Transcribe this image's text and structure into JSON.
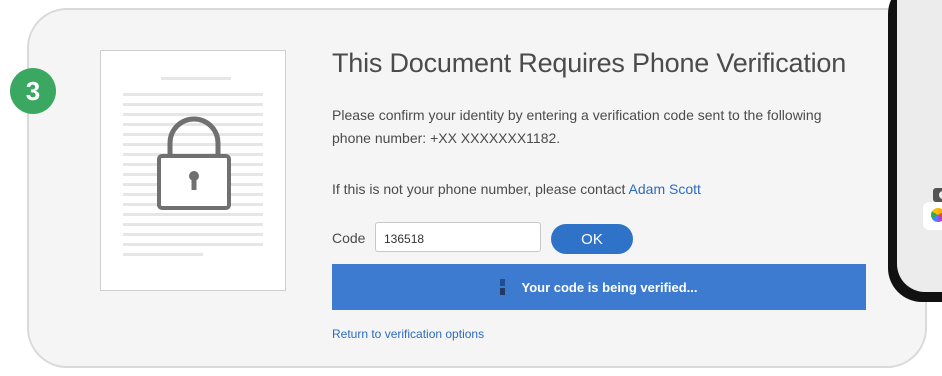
{
  "step": {
    "number": "3",
    "color": "#3aa860"
  },
  "document": {
    "title": "This Document Requires Phone Verification",
    "instruction": "Please confirm your identity by entering a verification code sent to the following phone number: +XX XXXXXXX1182.",
    "contact_prefix": "If this is not your phone number, please contact",
    "contact_name": "Adam Scott",
    "thumbnail_icon": "lock-icon"
  },
  "form": {
    "code_label": "Code",
    "code_value": "136518",
    "ok_label": "OK"
  },
  "status": {
    "message": "Your code is being verified...",
    "color": "#3c7bcf"
  },
  "links": {
    "return_label": "Return to verification options"
  },
  "phone": {
    "icons": [
      "camera-icon",
      "photos-icon"
    ]
  }
}
